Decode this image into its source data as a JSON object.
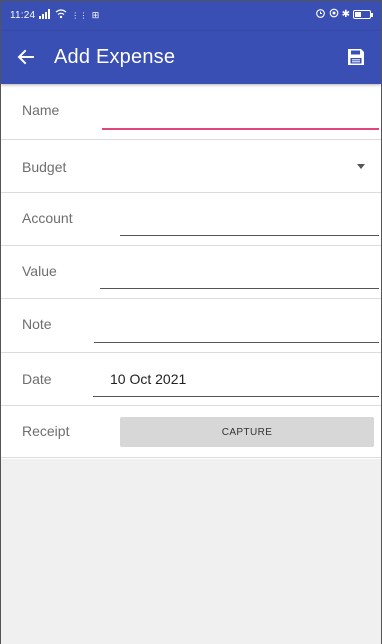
{
  "status_bar": {
    "time": "11:24",
    "signal_text": "▲ᵢ ≋ 2.42 ⊞"
  },
  "app_bar": {
    "title": "Add Expense",
    "back_icon": "arrow-left-icon",
    "save_icon": "save-icon"
  },
  "form": {
    "name": {
      "label": "Name",
      "value": ""
    },
    "budget": {
      "label": "Budget",
      "value": ""
    },
    "account": {
      "label": "Account",
      "value": ""
    },
    "value": {
      "label": "Value",
      "value": ""
    },
    "note": {
      "label": "Note",
      "value": ""
    },
    "date": {
      "label": "Date",
      "value": "10 Oct 2021"
    },
    "receipt": {
      "label": "Receipt",
      "button_label": "CAPTURE"
    }
  },
  "colors": {
    "primary": "#3a4fb4",
    "accent": "#e0457b",
    "button_bg": "#d7d7d7",
    "empty_bg": "#f0f0f0"
  }
}
